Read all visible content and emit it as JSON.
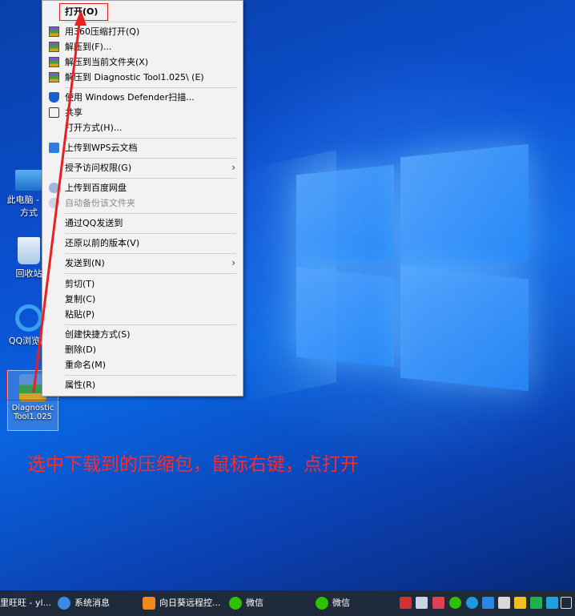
{
  "desktop": {
    "icons": [
      {
        "label": "此电脑 - 捷方式"
      },
      {
        "label": "回收站"
      },
      {
        "label": "QQ浏览器"
      },
      {
        "label": "Diagnostic Tool1.025"
      }
    ]
  },
  "context_menu": {
    "items": [
      {
        "label": "打开(O)"
      },
      {
        "label": "用360压缩打开(Q)"
      },
      {
        "label": "解压到(F)..."
      },
      {
        "label": "解压到当前文件夹(X)"
      },
      {
        "label": "解压到 Diagnostic Tool1.025\\ (E)"
      },
      {
        "label": "使用 Windows Defender扫描..."
      },
      {
        "label": "共享"
      },
      {
        "label": "打开方式(H)..."
      },
      {
        "label": "上传到WPS云文档"
      },
      {
        "label": "授予访问权限(G)"
      },
      {
        "label": "上传到百度网盘"
      },
      {
        "label": "自动备份该文件夹"
      },
      {
        "label": "通过QQ发送到"
      },
      {
        "label": "还原以前的版本(V)"
      },
      {
        "label": "发送到(N)"
      },
      {
        "label": "剪切(T)"
      },
      {
        "label": "复制(C)"
      },
      {
        "label": "粘贴(P)"
      },
      {
        "label": "创建快捷方式(S)"
      },
      {
        "label": "删除(D)"
      },
      {
        "label": "重命名(M)"
      },
      {
        "label": "属性(R)"
      }
    ],
    "submenu_arrow": "›"
  },
  "annotation": {
    "text": "选中下载到的压缩包，鼠标右键，点打开"
  },
  "taskbar": {
    "items": [
      {
        "label": "里旺旺 - yl..."
      },
      {
        "label": "系统消息"
      },
      {
        "label": "向日葵远程控..."
      },
      {
        "label": "微信"
      },
      {
        "label": "微信"
      }
    ]
  },
  "colors": {
    "annotation_red": "#ff2a2a",
    "menu_bg": "#f2f2f2",
    "taskbar_bg": "#1f2a3a"
  }
}
